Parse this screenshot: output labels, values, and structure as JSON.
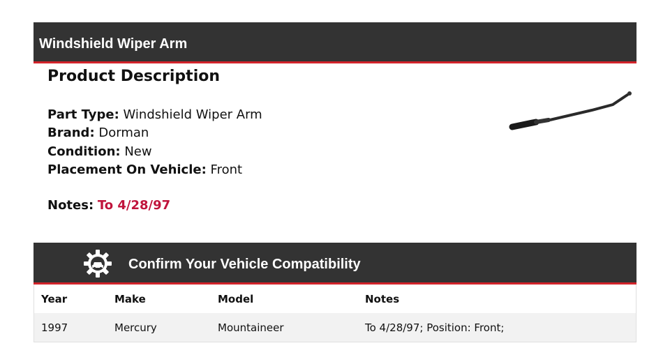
{
  "header": {
    "title": "Windshield Wiper Arm"
  },
  "description": {
    "heading": "Product Description",
    "specs": [
      {
        "label": "Part Type:",
        "value": "Windshield Wiper Arm"
      },
      {
        "label": "Brand:",
        "value": "Dorman"
      },
      {
        "label": "Condition:",
        "value": "New"
      },
      {
        "label": "Placement On Vehicle:",
        "value": "Front"
      }
    ],
    "notes": {
      "label": "Notes:",
      "value": "To 4/28/97"
    }
  },
  "compatibility": {
    "title": "Confirm Your Vehicle Compatibility",
    "icon": "gear-car-icon",
    "columns": [
      "Year",
      "Make",
      "Model",
      "Notes"
    ],
    "rows": [
      [
        "1997",
        "Mercury",
        "Mountaineer",
        "To 4/28/97; Position: Front;"
      ]
    ]
  },
  "colors": {
    "header_bg": "#333333",
    "accent_red": "#d2232a",
    "notes_value": "#c0143c",
    "row_bg": "#f2f2f2"
  }
}
